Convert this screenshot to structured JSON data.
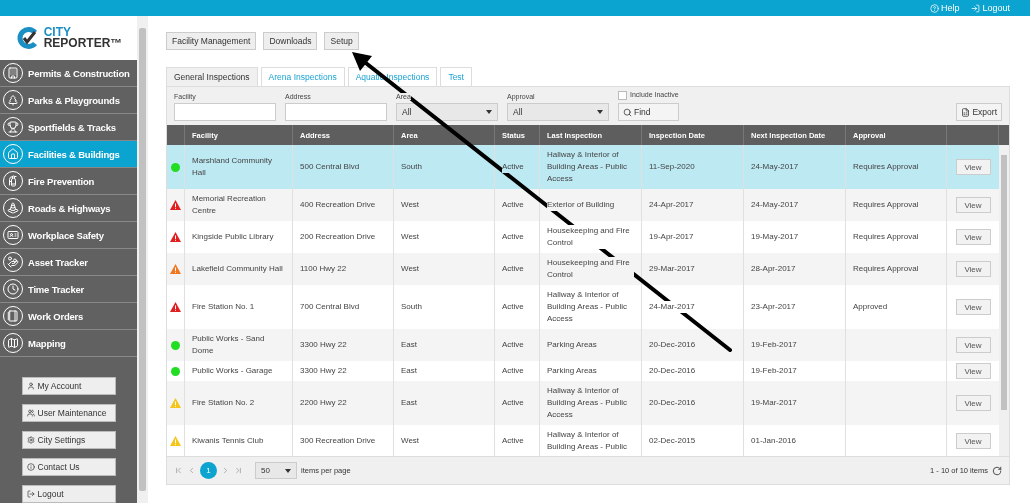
{
  "top_bar": {
    "links": [
      "Help",
      "Logout"
    ]
  },
  "logo": {
    "line1": "CITY",
    "line2": "REPORTER™"
  },
  "sidebar": {
    "items": [
      {
        "label": "Permits & Construction",
        "selected": false
      },
      {
        "label": "Parks & Playgrounds",
        "selected": false
      },
      {
        "label": "Sportfields & Tracks",
        "selected": false
      },
      {
        "label": "Facilities & Buildings",
        "selected": true
      },
      {
        "label": "Fire Prevention",
        "selected": false
      },
      {
        "label": "Roads & Highways",
        "selected": false
      },
      {
        "label": "Workplace Safety",
        "selected": false
      },
      {
        "label": "Asset Tracker",
        "selected": false
      },
      {
        "label": "Time Tracker",
        "selected": false
      },
      {
        "label": "Work Orders",
        "selected": false
      },
      {
        "label": "Mapping",
        "selected": false
      }
    ],
    "buttons": [
      "My Account",
      "User Maintenance",
      "City Settings",
      "Contact Us",
      "Logout"
    ]
  },
  "toolbar": {
    "buttons": [
      "Facility Management",
      "Downloads",
      "Setup"
    ]
  },
  "tabs": [
    {
      "label": "General Inspections",
      "selected": true
    },
    {
      "label": "Arena Inspections",
      "selected": false
    },
    {
      "label": "Aquatic Inspections",
      "selected": false
    },
    {
      "label": "Test",
      "selected": false
    }
  ],
  "filters": {
    "facility_label": "Facility",
    "address_label": "Address",
    "area_label": "Area",
    "area_value": "All",
    "approval_label": "Approval",
    "approval_value": "All",
    "include_inactive": {
      "label": "Include Inactive",
      "checked": false
    },
    "find_button": "Find",
    "export_button": "Export"
  },
  "table": {
    "columns": [
      "Facility",
      "Address",
      "Area",
      "Status",
      "Last Inspection",
      "Inspection Date",
      "Next Inspection Date",
      "Approval"
    ],
    "rows": [
      {
        "kind": "dot",
        "color": "#22dd22",
        "selected": true,
        "facility": "Marshland Community Hall",
        "address": "500 Central Blvd",
        "area": "South",
        "status": "Active",
        "last_inspection": "Hallway & Interior of Building Areas - Public Access",
        "inspection_date": "11-Sep-2020",
        "next_date": "24-May-2017",
        "approval": "Requires Approval",
        "action": "View"
      },
      {
        "kind": "warning",
        "color": "#e02020",
        "selected": false,
        "facility": "Memorial Recreation Centre",
        "address": "400 Recreation Drive",
        "area": "West",
        "status": "Active",
        "last_inspection": "Exterior of Building",
        "inspection_date": "24-Apr-2017",
        "next_date": "24-May-2017",
        "approval": "Requires Approval",
        "action": "View"
      },
      {
        "kind": "warning",
        "color": "#e02020",
        "selected": false,
        "facility": "Kingside Public Library",
        "address": "200 Recreation Drive",
        "area": "West",
        "status": "Active",
        "last_inspection": "Housekeeping and Fire Control",
        "inspection_date": "19-Apr-2017",
        "next_date": "19-May-2017",
        "approval": "Requires Approval",
        "action": "View"
      },
      {
        "kind": "warning",
        "color": "#f07820",
        "selected": false,
        "facility": "Lakefield Community Hall",
        "address": "1100 Hwy 22",
        "area": "West",
        "status": "Active",
        "last_inspection": "Housekeeping and Fire Control",
        "inspection_date": "29-Mar-2017",
        "next_date": "28-Apr-2017",
        "approval": "Requires Approval",
        "action": "View"
      },
      {
        "kind": "warning",
        "color": "#e02020",
        "selected": false,
        "facility": "Fire Station No. 1",
        "address": "700 Central Blvd",
        "area": "South",
        "status": "Active",
        "last_inspection": "Hallway & Interior of Building Areas - Public Access",
        "inspection_date": "24-Mar-2017",
        "next_date": "23-Apr-2017",
        "approval": "Approved",
        "action": "View"
      },
      {
        "kind": "dot",
        "color": "#22dd22",
        "selected": false,
        "facility": "Public Works - Sand Dome",
        "address": "3300 Hwy 22",
        "area": "East",
        "status": "Active",
        "last_inspection": "Parking Areas",
        "inspection_date": "20-Dec-2016",
        "next_date": "19-Feb-2017",
        "action": "View"
      },
      {
        "kind": "dot",
        "color": "#22dd22",
        "selected": false,
        "facility": "Public Works - Garage",
        "address": "3300 Hwy 22",
        "area": "East",
        "status": "Active",
        "last_inspection": "Parking Areas",
        "inspection_date": "20-Dec-2016",
        "next_date": "19-Feb-2017",
        "action": "View"
      },
      {
        "kind": "warning",
        "color": "#f5c518",
        "selected": false,
        "facility": "Fire Station No. 2",
        "address": "2200 Hwy 22",
        "area": "East",
        "status": "Active",
        "last_inspection": "Hallway & Interior of Building Areas - Public Access",
        "inspection_date": "20-Dec-2016",
        "next_date": "19-Mar-2017",
        "action": "View"
      },
      {
        "kind": "warning",
        "color": "#f5c518",
        "selected": false,
        "facility": "Kiwanis Tennis Club",
        "address": "300 Recreation Drive",
        "area": "West",
        "status": "Active",
        "last_inspection": "Hallway & Interior of Building Areas - Public",
        "inspection_date": "02-Dec-2015",
        "next_date": "01-Jan-2016",
        "action": "View"
      }
    ]
  },
  "pager": {
    "page": "1",
    "per_page": "50",
    "per_page_label": "items per page",
    "summary": "1 - 10 of 10 items"
  }
}
